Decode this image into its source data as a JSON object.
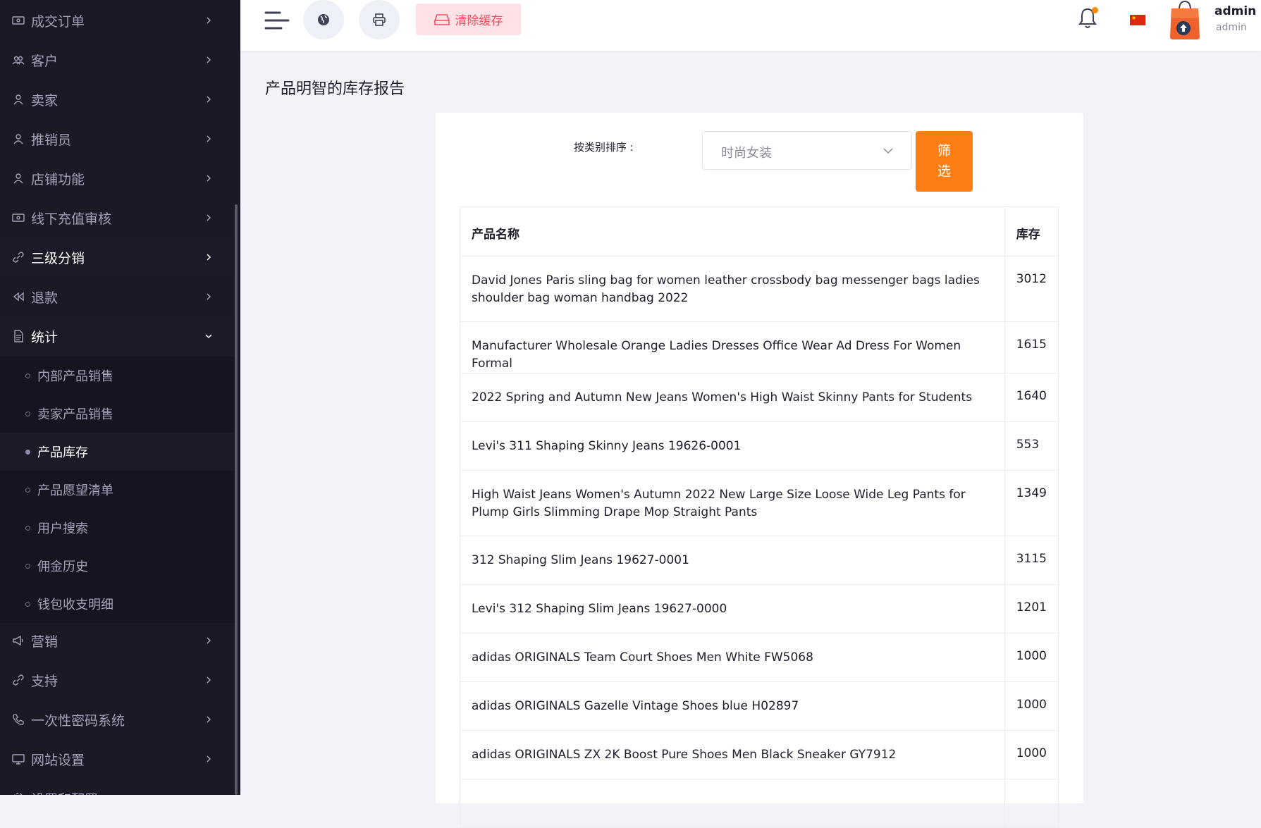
{
  "sidebar": {
    "items": [
      {
        "label": "成交订单",
        "icon": "money-icon"
      },
      {
        "label": "客户",
        "icon": "users-icon"
      },
      {
        "label": "卖家",
        "icon": "user-icon"
      },
      {
        "label": "推销员",
        "icon": "user-icon"
      },
      {
        "label": "店铺功能",
        "icon": "user-icon"
      },
      {
        "label": "线下充值审核",
        "icon": "money-icon"
      },
      {
        "label": "三级分销",
        "icon": "link-icon"
      },
      {
        "label": "退款",
        "icon": "backward-icon"
      },
      {
        "label": "统计",
        "icon": "document-icon"
      },
      {
        "label": "营销",
        "icon": "megaphone-icon"
      },
      {
        "label": "支持",
        "icon": "link-icon"
      },
      {
        "label": "一次性密码系统",
        "icon": "phone-icon"
      },
      {
        "label": "网站设置",
        "icon": "monitor-icon"
      },
      {
        "label": "设置和配置",
        "icon": "gear-icon"
      }
    ],
    "stats_sub": [
      "内部产品销售",
      "卖家产品销售",
      "产品库存",
      "产品愿望清单",
      "用户搜索",
      "佣金历史",
      "钱包收支明细"
    ]
  },
  "topbar": {
    "clear_cache_label": "清除缓存",
    "user_name": "admin",
    "user_role": "admin"
  },
  "page": {
    "title": "产品明智的库存报告",
    "sort_label": "按类别排序 :",
    "category_value": "时尚女装",
    "filter_label_1": "筛",
    "filter_label_2": "选"
  },
  "table": {
    "headers": [
      "产品名称",
      "库存"
    ],
    "rows": [
      {
        "name": "David Jones Paris sling bag for women leather crossbody bag messenger bags ladies shoulder bag woman handbag 2022",
        "stock": "3012"
      },
      {
        "name": "Manufacturer Wholesale Orange Ladies Dresses Office Wear Ad Dress For Women Formal",
        "stock": "1615"
      },
      {
        "name": "2022 Spring and Autumn New Jeans Women's High Waist Skinny Pants for Students",
        "stock": "1640"
      },
      {
        "name": "Levi's 311 Shaping Skinny Jeans 19626-0001",
        "stock": "553"
      },
      {
        "name": "High Waist Jeans Women's Autumn 2022 New Large Size Loose Wide Leg Pants for Plump Girls Slimming Drape Mop Straight Pants",
        "stock": "1349"
      },
      {
        "name": "312 Shaping Slim Jeans 19627-0001",
        "stock": "3115"
      },
      {
        "name": "Levi's 312 Shaping Slim Jeans 19627-0000",
        "stock": "1201"
      },
      {
        "name": "adidas ORIGINALS Team Court Shoes Men White FW5068",
        "stock": "1000"
      },
      {
        "name": "adidas ORIGINALS Gazelle Vintage Shoes blue H02897",
        "stock": "1000"
      },
      {
        "name": "adidas ORIGINALS ZX 2K Boost Pure Shoes Men Black Sneaker GY7912",
        "stock": "1000"
      }
    ]
  },
  "colors": {
    "sidebar_bg": "#1a1a27",
    "accent_orange": "#fd7e14",
    "clear_cache_bg": "#ffe2e5",
    "clear_cache_text": "#f64e60"
  }
}
